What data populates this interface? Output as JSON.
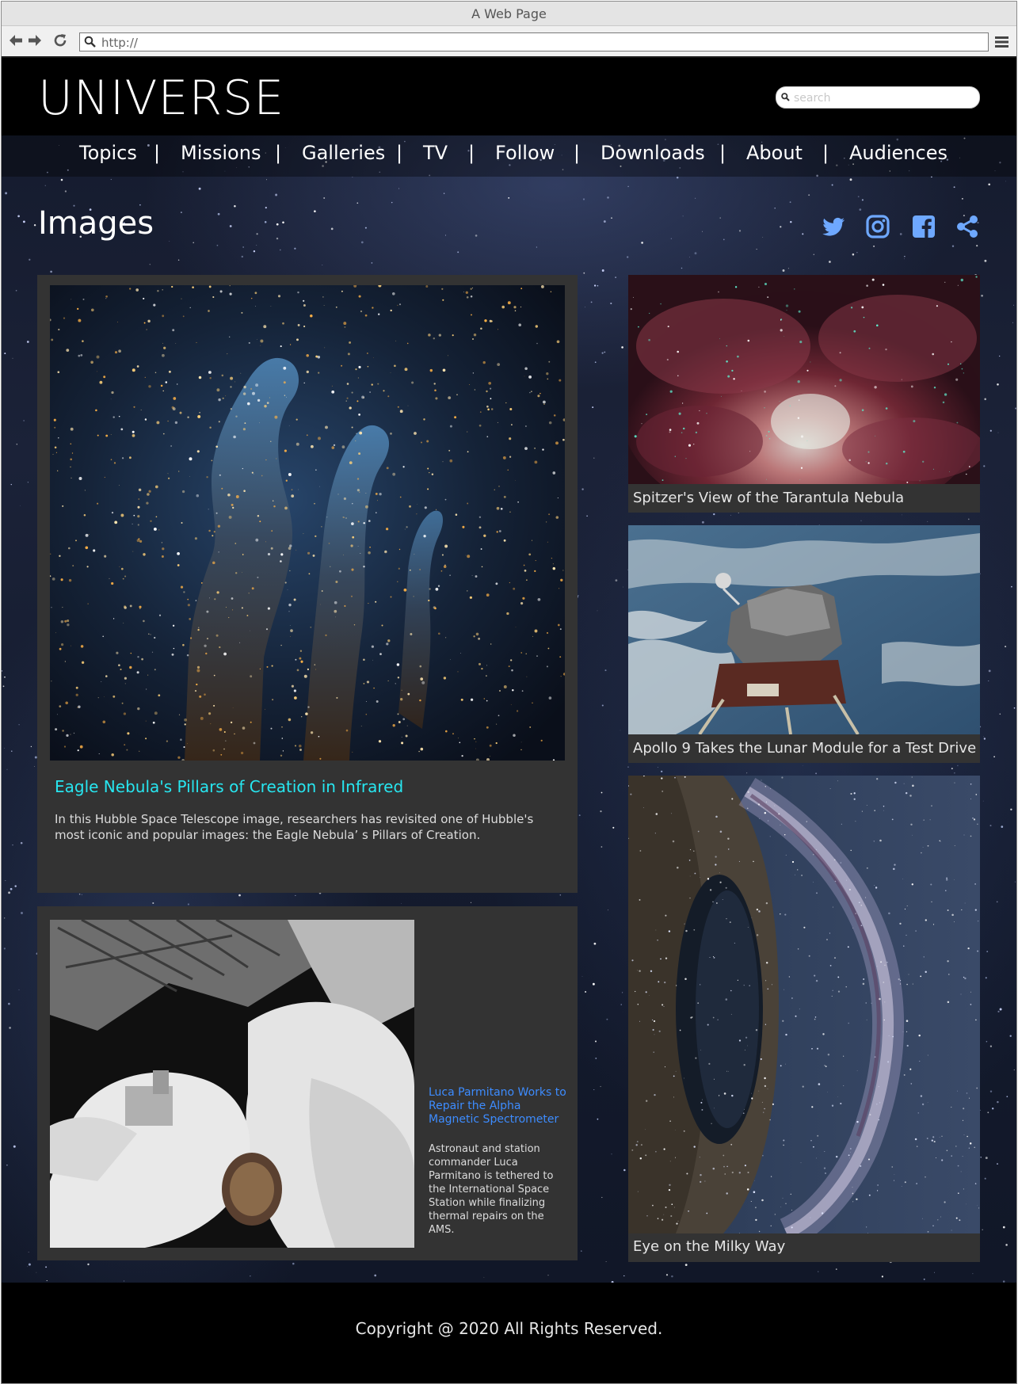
{
  "browser": {
    "window_title": "A Web Page",
    "url": "http://"
  },
  "site": {
    "logo": "UNIVERSE",
    "search_placeholder": "search"
  },
  "nav": {
    "items": [
      {
        "label": "Topics"
      },
      {
        "label": "Missions"
      },
      {
        "label": "Galleries"
      },
      {
        "label": "TV"
      },
      {
        "label": "Follow"
      },
      {
        "label": "Downloads"
      },
      {
        "label": "About"
      },
      {
        "label": "Audiences"
      }
    ],
    "separator": "|"
  },
  "page": {
    "title": "Images",
    "social": [
      "twitter-icon",
      "instagram-icon",
      "facebook-icon",
      "share-icon"
    ],
    "social_color": "#6ea8ff"
  },
  "featured": {
    "title": "Eagle Nebula's Pillars of Creation in Infrared",
    "description": "In this Hubble Space Telescope image, researchers has revisited one of Hubble's most iconic and popular images: the Eagle Nebula’ s Pillars of Creation.",
    "title_color": "#27e6f0"
  },
  "second": {
    "title": "Luca Parmitano Works to Repair the Alpha Magnetic Spectrometer",
    "description": "Astronaut and station commander Luca Parmitano is tethered to the International Space Station while finalizing thermal repairs on the AMS.",
    "title_color": "#3d8cff"
  },
  "side_cards": [
    {
      "caption": "Spitzer's View of the Tarantula Nebula"
    },
    {
      "caption": "Apollo 9 Takes the Lunar Module for a Test Drive"
    },
    {
      "caption": "Eye on the Milky Way"
    }
  ],
  "footer": {
    "copyright": "Copyright @ 2020  All Rights Reserved."
  }
}
